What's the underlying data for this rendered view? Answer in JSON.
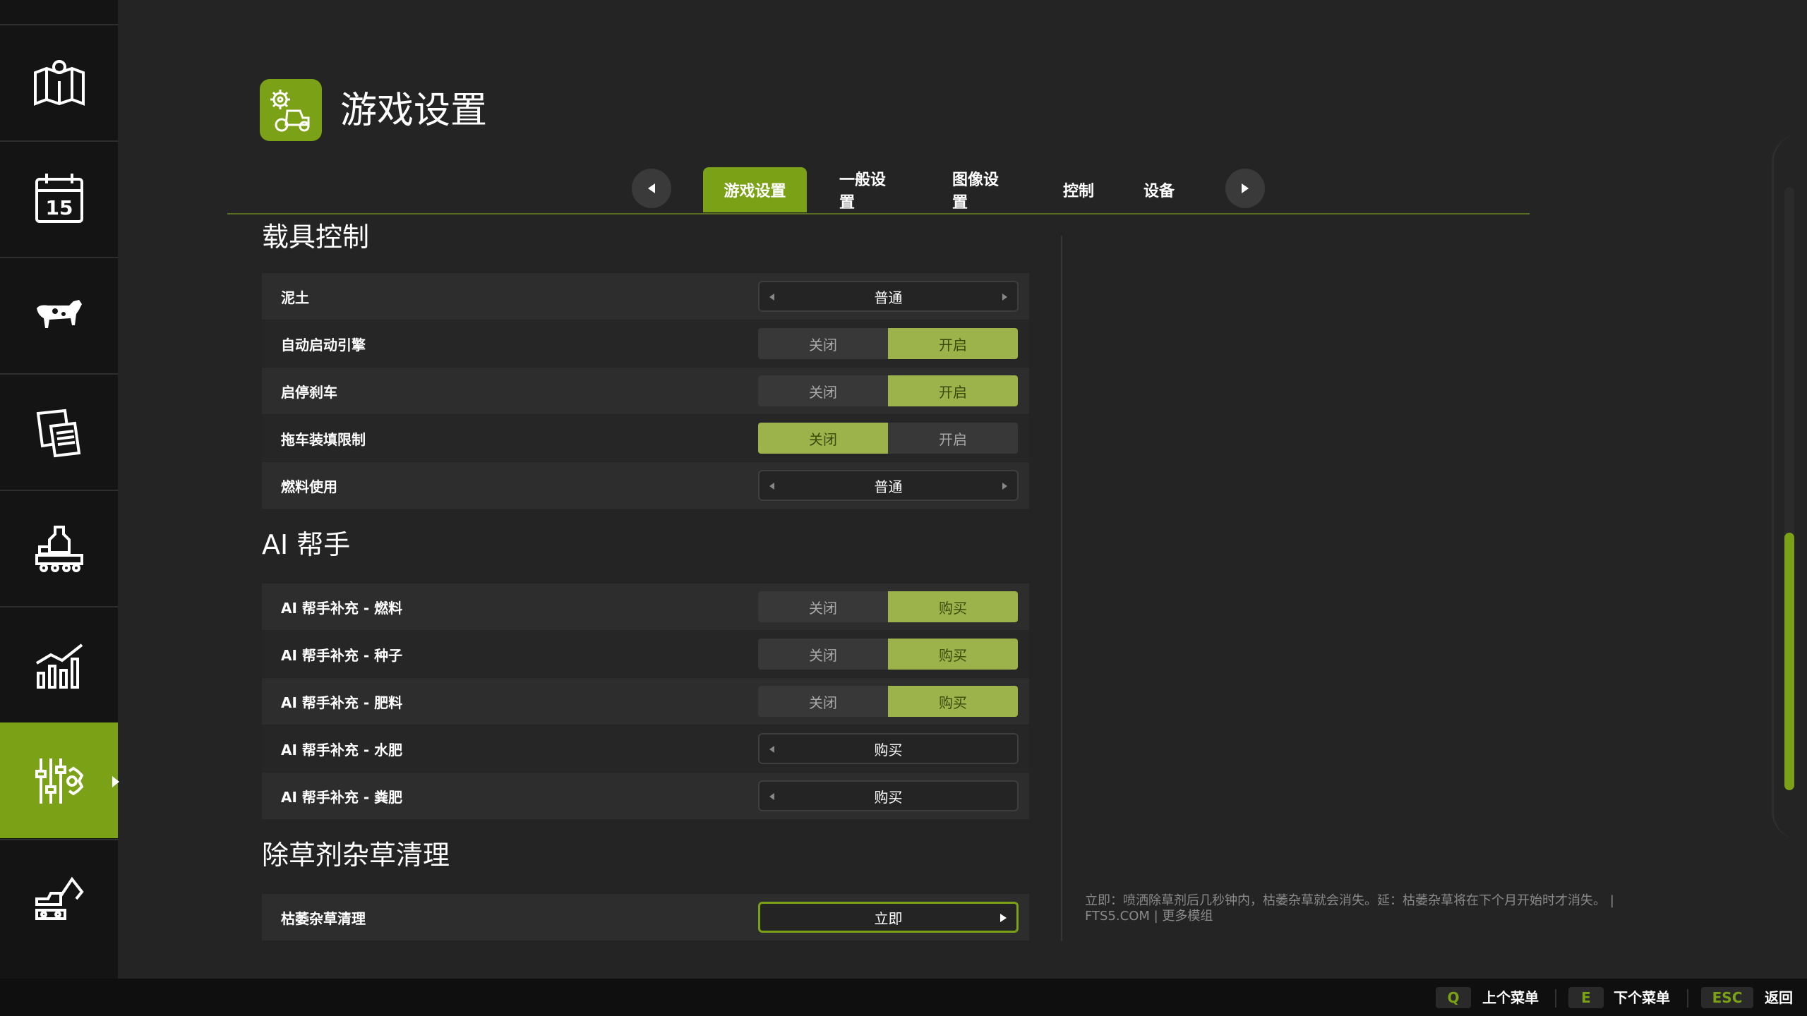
{
  "header": {
    "title": "游戏设置"
  },
  "tabs": {
    "items": [
      {
        "label": "游戏设置",
        "active": true
      },
      {
        "label": "一般设置"
      },
      {
        "label": "图像设置"
      },
      {
        "label": "控制"
      },
      {
        "label": "设备"
      }
    ]
  },
  "sections": {
    "vehicle": {
      "title": "载具控制"
    },
    "ai": {
      "title": "AI 帮手"
    },
    "weed": {
      "title": "除草剂杂草清理"
    }
  },
  "rows": {
    "dirt": {
      "label": "泥土",
      "value": "普通"
    },
    "auto_engine": {
      "label": "自动启动引擎",
      "off": "关闭",
      "on": "开启",
      "selected": "on"
    },
    "park_brake": {
      "label": "启停刹车",
      "off": "关闭",
      "on": "开启",
      "selected": "on"
    },
    "trailer_limit": {
      "label": "拖车装填限制",
      "off": "关闭",
      "on": "开启",
      "selected": "off"
    },
    "fuel_usage": {
      "label": "燃料使用",
      "value": "普通"
    },
    "ai_fuel": {
      "label": "AI 帮手补充 - 燃料",
      "off": "关闭",
      "on": "购买",
      "selected": "on"
    },
    "ai_seed": {
      "label": "AI 帮手补充 - 种子",
      "off": "关闭",
      "on": "购买",
      "selected": "on"
    },
    "ai_fert": {
      "label": "AI 帮手补充 - 肥料",
      "off": "关闭",
      "on": "购买",
      "selected": "on"
    },
    "ai_slurry": {
      "label": "AI 帮手补充 - 水肥",
      "value": "购买"
    },
    "ai_manure": {
      "label": "AI 帮手补充 - 粪肥",
      "value": "购买"
    },
    "weed_clear": {
      "label": "枯萎杂草清理",
      "value": "立即"
    }
  },
  "help_text": "立即：喷洒除草剂后几秒钟内，枯萎杂草就会消失。延：枯萎杂草将在下个月开始时才消失。 | FTS5.COM | 更多模组",
  "footer": {
    "prev": {
      "key": "Q",
      "label": "上个菜单"
    },
    "next": {
      "key": "E",
      "label": "下个菜单"
    },
    "back": {
      "key": "ESC",
      "label": "返回"
    }
  },
  "sidebar": {
    "items": [
      {
        "icon": "map-icon"
      },
      {
        "icon": "calendar-icon",
        "text": "15"
      },
      {
        "icon": "cow-icon"
      },
      {
        "icon": "contracts-icon"
      },
      {
        "icon": "production-icon"
      },
      {
        "icon": "statistics-icon"
      },
      {
        "icon": "settings-icon",
        "active": true
      },
      {
        "icon": "excavator-icon"
      }
    ]
  },
  "colors": {
    "accent": "#7ba116",
    "toggle_on": "#9cb24a",
    "background": "#242424"
  }
}
